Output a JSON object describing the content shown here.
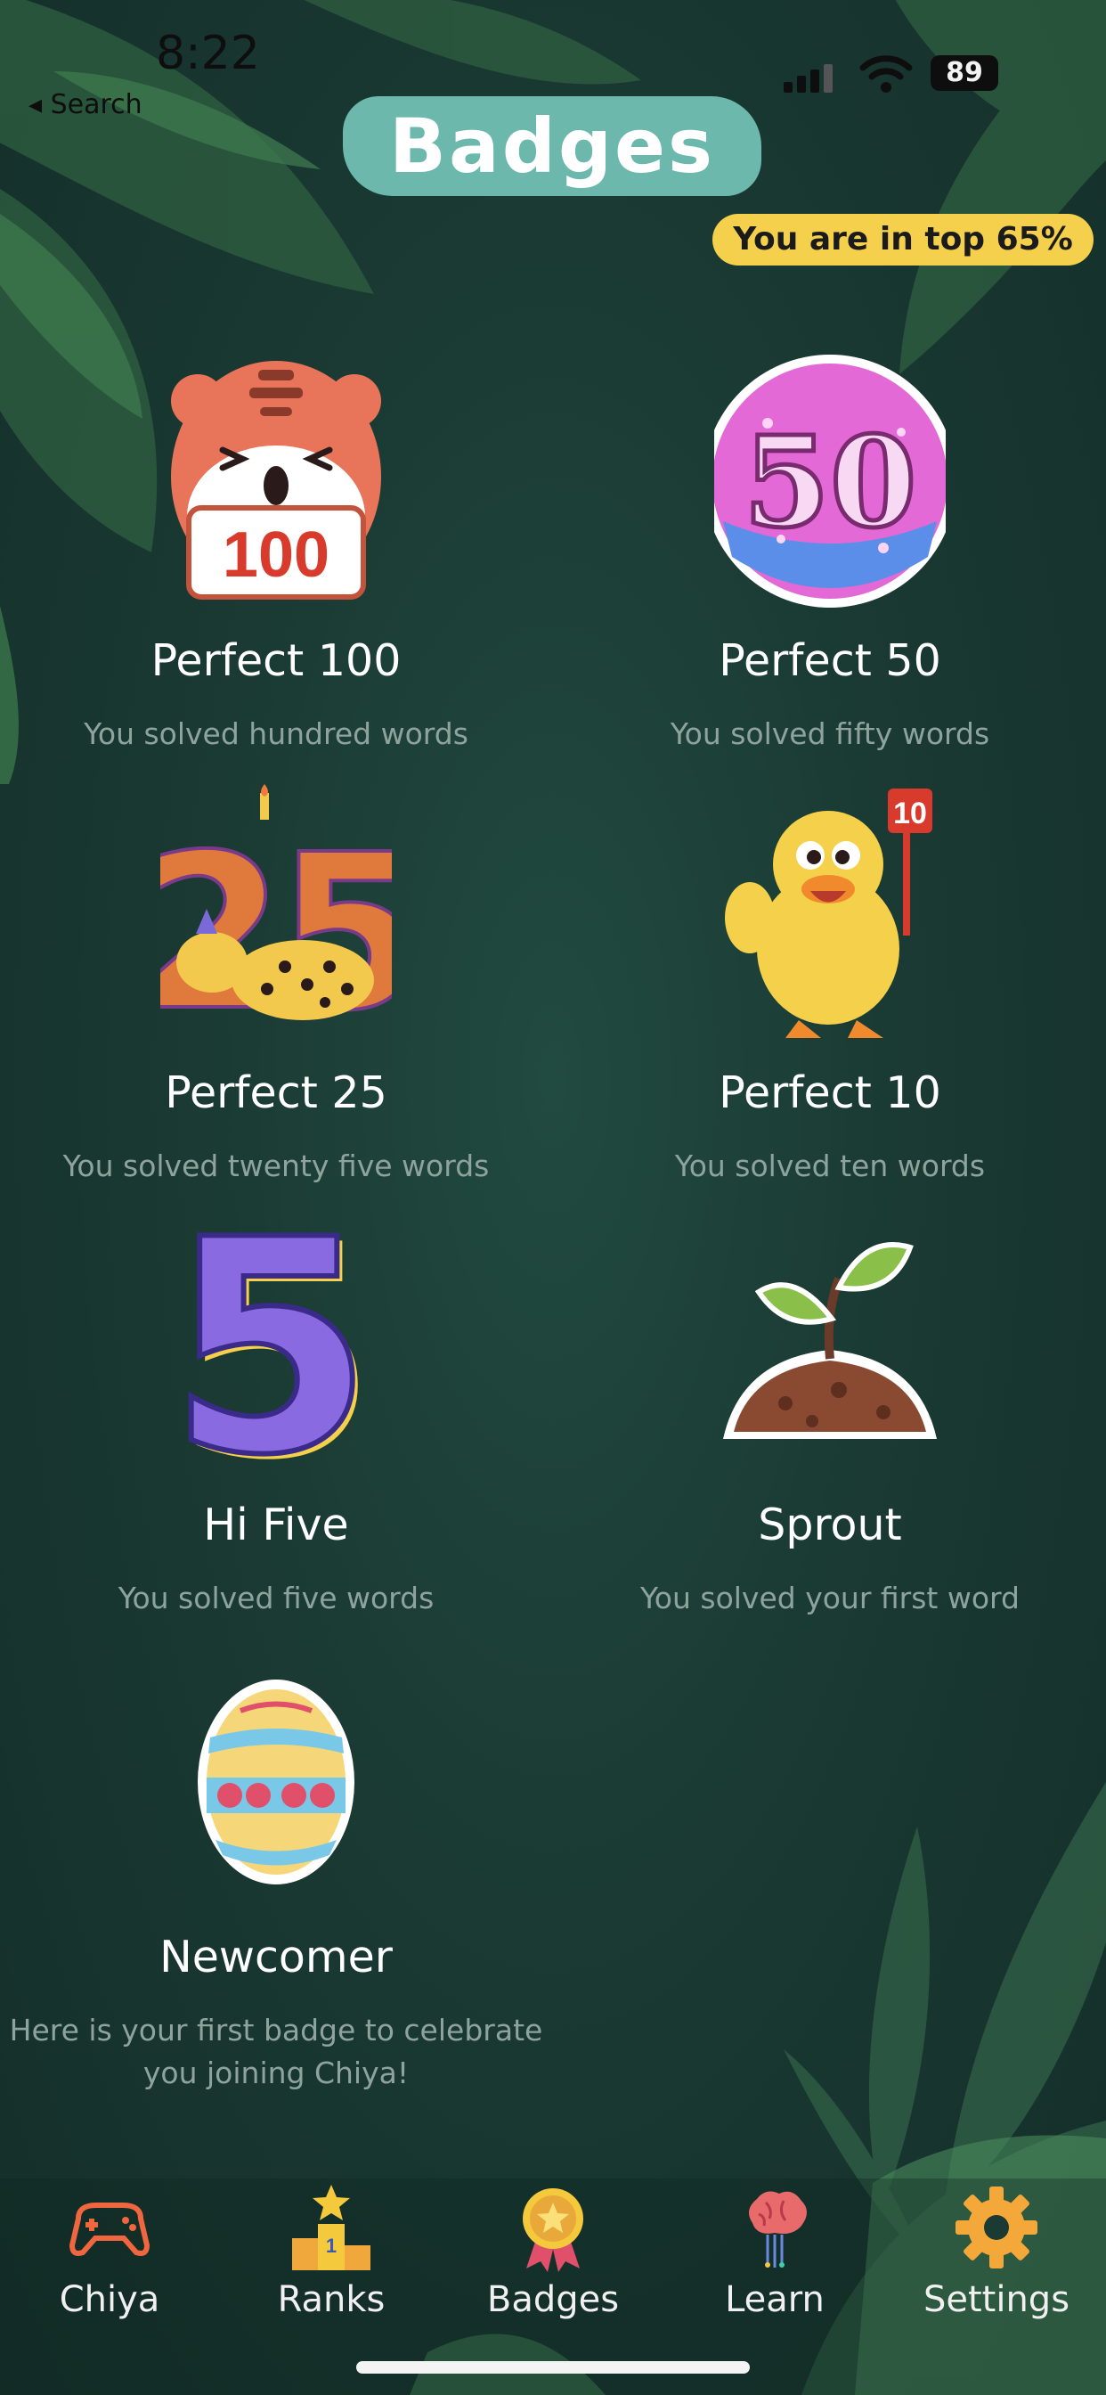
{
  "status_bar": {
    "time": "8:22",
    "back_label": "Search",
    "battery": "89"
  },
  "header": {
    "title": "Badges",
    "rank_text": "You are in top 65%"
  },
  "badges": [
    {
      "name": "Perfect 100",
      "description": "You solved hundred words",
      "art_text": "100",
      "icon": "tiger-100-icon"
    },
    {
      "name": "Perfect 50",
      "description": "You solved fifty words",
      "art_text": "50",
      "icon": "disc-50-icon"
    },
    {
      "name": "Perfect 25",
      "description": "You solved twenty five words",
      "art_text": "25",
      "icon": "leopard-25-icon"
    },
    {
      "name": "Perfect 10",
      "description": "You solved ten words",
      "art_text": "10",
      "icon": "chick-10-icon"
    },
    {
      "name": "Hi Five",
      "description": "You solved five words",
      "art_text": "5",
      "icon": "number-five-icon"
    },
    {
      "name": "Sprout",
      "description": "You solved your first word",
      "icon": "sprout-icon"
    },
    {
      "name": "Newcomer",
      "description": "Here is your first badge to celebrate you joining Chiya!",
      "icon": "easter-egg-icon"
    }
  ],
  "nav": {
    "items": [
      {
        "label": "Chiya",
        "icon": "gamepad-icon"
      },
      {
        "label": "Ranks",
        "icon": "podium-icon"
      },
      {
        "label": "Badges",
        "icon": "medal-icon",
        "active": true
      },
      {
        "label": "Learn",
        "icon": "brain-icon"
      },
      {
        "label": "Settings",
        "icon": "gear-icon"
      }
    ]
  },
  "colors": {
    "background": "#1a3a33",
    "title_pill": "#6db8ad",
    "rank_badge": "#f5d04c",
    "description_text": "#8fa39d"
  }
}
